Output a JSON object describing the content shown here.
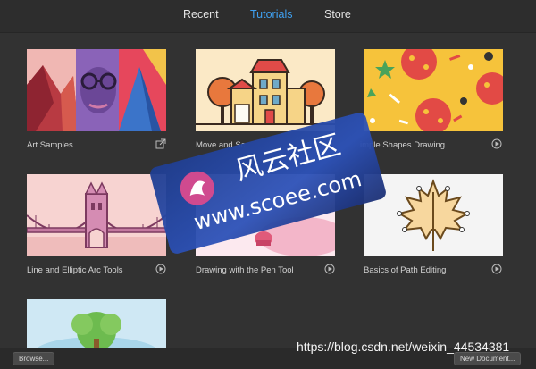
{
  "tabs": [
    "Recent",
    "Tutorials",
    "Store"
  ],
  "cards": [
    {
      "title": "Art Samples",
      "icon": "external-link-icon"
    },
    {
      "title": "Move and Sc",
      "icon": "play-icon"
    },
    {
      "title": "imple Shapes Drawing",
      "icon": "play-icon"
    },
    {
      "title": "Line and Elliptic Arc Tools",
      "icon": "play-icon"
    },
    {
      "title": "Drawing with the Pen Tool",
      "icon": "play-icon"
    },
    {
      "title": "Basics of Path Editing",
      "icon": "play-icon"
    },
    {
      "title": "",
      "icon": ""
    }
  ],
  "footer": {
    "browse": "Browse...",
    "new_document": "New Document..."
  },
  "watermark": {
    "site_name": "风云社区",
    "site_url": "www.scoee.com",
    "blog_url": "https://blog.csdn.net/weixin_44534381"
  },
  "colors": {
    "active_tab": "#3fa1f2",
    "background": "#323232"
  }
}
